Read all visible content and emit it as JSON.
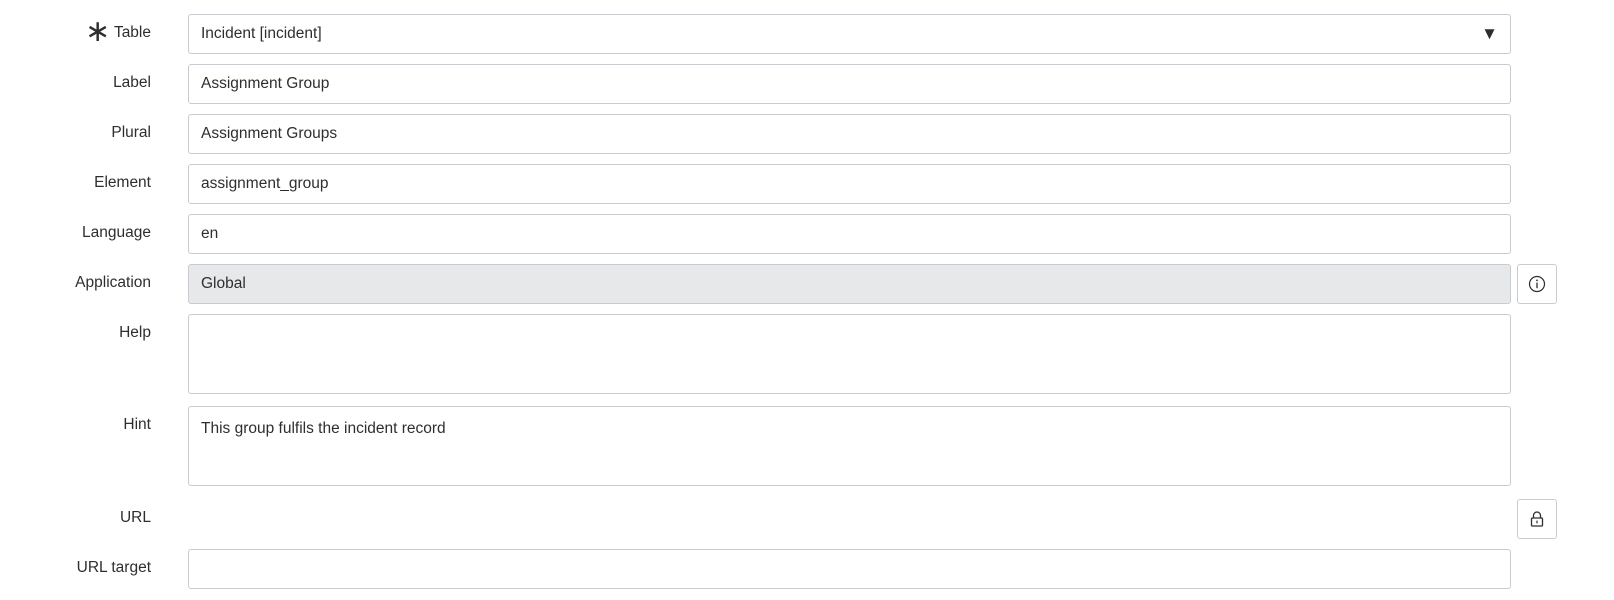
{
  "form": {
    "table": {
      "label": "Table",
      "mandatory_marker": "∗",
      "value": "Incident [incident]",
      "dropdown_icon": "triangle-down-icon"
    },
    "label_field": {
      "label": "Label",
      "value": "Assignment Group"
    },
    "plural": {
      "label": "Plural",
      "value": "Assignment Groups"
    },
    "element": {
      "label": "Element",
      "value": "assignment_group"
    },
    "language": {
      "label": "Language",
      "value": "en"
    },
    "application": {
      "label": "Application",
      "value": "Global",
      "info_icon": "info-circle-icon"
    },
    "help": {
      "label": "Help",
      "value": ""
    },
    "hint": {
      "label": "Hint",
      "value": "This group fulfils the incident record"
    },
    "url": {
      "label": "URL",
      "lock_icon": "lock-icon"
    },
    "url_target": {
      "label": "URL target",
      "value": ""
    }
  }
}
